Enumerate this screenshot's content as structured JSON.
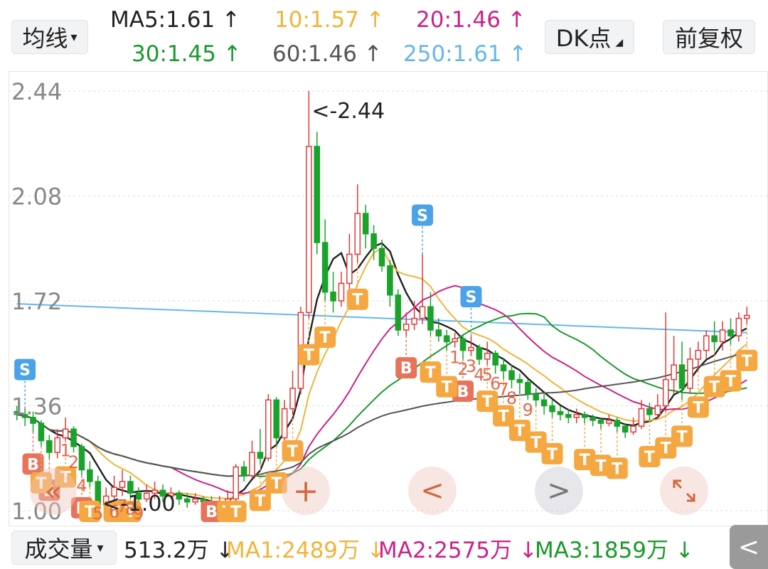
{
  "top": {
    "indicator_label": "均线",
    "dk_label": "DK点",
    "adjust_label": "前复权",
    "ma_lines": [
      {
        "text": "MA5:1.61",
        "arrow": "up",
        "color": "#222222"
      },
      {
        "text": "10:1.57",
        "arrow": "up",
        "color": "#f0b43c"
      },
      {
        "text": "20:1.46",
        "arrow": "up",
        "color": "#cc2288"
      },
      {
        "text": "30:1.45",
        "arrow": "up",
        "color": "#1a9a2a"
      },
      {
        "text": "60:1.46",
        "arrow": "up",
        "color": "#555555"
      },
      {
        "text": "250:1.61",
        "arrow": "up",
        "color": "#66b6ee"
      }
    ]
  },
  "bottom": {
    "volume_label": "成交量",
    "volume_value": "513.2万",
    "ma1": "MA1:2489万",
    "ma2": "MA2:2575万",
    "ma3": "MA3:1859万"
  },
  "controls": {
    "zoom_in": "+",
    "prev": "<",
    "next": ">",
    "rewind": "«",
    "fullscreen": "expand-icon",
    "back": "<"
  },
  "chart_data": {
    "type": "candlestick",
    "y_axis_ticks": [
      "2.44",
      "2.08",
      "1.72",
      "1.36",
      "1.00"
    ],
    "ylim": [
      1.0,
      2.44
    ],
    "max_label": "<-2.44",
    "min_label": "<-1.00",
    "colors": {
      "up": "#e23a3a",
      "down": "#1aa32a",
      "ma5": "#222222",
      "ma10": "#f0b43c",
      "ma20": "#cc2288",
      "ma30": "#1a9a2a",
      "ma60": "#555555",
      "ma250": "#66b6ee",
      "t_badge": "#f5a742",
      "s_badge": "#4aa3e8",
      "b_badge": "#e8735a"
    },
    "candles": [
      [
        1.34,
        1.33,
        1.36,
        1.31
      ],
      [
        1.33,
        1.32,
        1.35,
        1.29
      ],
      [
        1.32,
        1.3,
        1.34,
        1.27
      ],
      [
        1.3,
        1.24,
        1.31,
        1.22
      ],
      [
        1.24,
        1.2,
        1.26,
        1.18
      ],
      [
        1.2,
        1.25,
        1.28,
        1.18
      ],
      [
        1.25,
        1.28,
        1.32,
        1.24
      ],
      [
        1.28,
        1.22,
        1.29,
        1.2
      ],
      [
        1.22,
        1.14,
        1.23,
        1.12
      ],
      [
        1.14,
        1.1,
        1.17,
        1.08
      ],
      [
        1.1,
        1.02,
        1.12,
        1.0
      ],
      [
        1.02,
        1.05,
        1.08,
        1.0
      ],
      [
        1.05,
        1.08,
        1.12,
        1.03
      ],
      [
        1.08,
        1.1,
        1.14,
        1.05
      ],
      [
        1.1,
        1.06,
        1.12,
        1.04
      ],
      [
        1.06,
        1.04,
        1.08,
        1.02
      ],
      [
        1.04,
        1.06,
        1.09,
        1.03
      ],
      [
        1.06,
        1.07,
        1.1,
        1.04
      ],
      [
        1.07,
        1.05,
        1.09,
        1.03
      ],
      [
        1.05,
        1.06,
        1.08,
        1.04
      ],
      [
        1.06,
        1.04,
        1.07,
        1.02
      ],
      [
        1.04,
        1.03,
        1.06,
        1.01
      ],
      [
        1.03,
        1.04,
        1.06,
        1.02
      ],
      [
        1.04,
        1.03,
        1.05,
        1.01
      ],
      [
        1.03,
        1.02,
        1.05,
        1.0
      ],
      [
        1.02,
        1.03,
        1.05,
        1.01
      ],
      [
        1.03,
        1.04,
        1.07,
        1.02
      ],
      [
        1.04,
        1.15,
        1.16,
        1.03
      ],
      [
        1.15,
        1.12,
        1.17,
        1.1
      ],
      [
        1.12,
        1.2,
        1.24,
        1.11
      ],
      [
        1.2,
        1.18,
        1.28,
        1.16
      ],
      [
        1.18,
        1.38,
        1.4,
        1.17
      ],
      [
        1.38,
        1.25,
        1.39,
        1.22
      ],
      [
        1.25,
        1.35,
        1.38,
        1.24
      ],
      [
        1.35,
        1.42,
        1.48,
        1.33
      ],
      [
        1.42,
        1.68,
        1.7,
        1.4
      ],
      [
        1.68,
        2.25,
        2.44,
        1.66
      ],
      [
        2.25,
        1.92,
        2.3,
        1.88
      ],
      [
        1.92,
        1.75,
        2.0,
        1.72
      ],
      [
        1.75,
        1.72,
        1.82,
        1.68
      ],
      [
        1.72,
        1.78,
        1.82,
        1.7
      ],
      [
        1.78,
        1.88,
        1.95,
        1.76
      ],
      [
        1.88,
        2.02,
        2.12,
        1.85
      ],
      [
        2.02,
        1.95,
        2.05,
        1.9
      ],
      [
        1.95,
        1.9,
        1.98,
        1.86
      ],
      [
        1.9,
        1.84,
        1.93,
        1.82
      ],
      [
        1.84,
        1.74,
        1.86,
        1.7
      ],
      [
        1.74,
        1.62,
        1.76,
        1.6
      ],
      [
        1.62,
        1.64,
        1.68,
        1.6
      ],
      [
        1.64,
        1.66,
        1.72,
        1.62
      ],
      [
        1.66,
        1.7,
        1.88,
        1.64
      ],
      [
        1.7,
        1.62,
        1.75,
        1.6
      ],
      [
        1.62,
        1.6,
        1.66,
        1.58
      ],
      [
        1.6,
        1.58,
        1.62,
        1.55
      ],
      [
        1.58,
        1.59,
        1.61,
        1.56
      ],
      [
        1.59,
        1.55,
        1.6,
        1.52
      ],
      [
        1.55,
        1.56,
        1.6,
        1.53
      ],
      [
        1.56,
        1.52,
        1.57,
        1.5
      ],
      [
        1.52,
        1.54,
        1.58,
        1.5
      ],
      [
        1.54,
        1.5,
        1.55,
        1.47
      ],
      [
        1.5,
        1.48,
        1.52,
        1.45
      ],
      [
        1.48,
        1.45,
        1.5,
        1.42
      ],
      [
        1.45,
        1.44,
        1.47,
        1.4
      ],
      [
        1.44,
        1.4,
        1.45,
        1.38
      ],
      [
        1.4,
        1.38,
        1.42,
        1.36
      ],
      [
        1.38,
        1.36,
        1.4,
        1.33
      ],
      [
        1.36,
        1.34,
        1.38,
        1.32
      ],
      [
        1.34,
        1.33,
        1.36,
        1.31
      ],
      [
        1.33,
        1.32,
        1.35,
        1.3
      ],
      [
        1.32,
        1.33,
        1.35,
        1.3
      ],
      [
        1.33,
        1.32,
        1.34,
        1.3
      ],
      [
        1.32,
        1.31,
        1.33,
        1.29
      ],
      [
        1.31,
        1.3,
        1.32,
        1.28
      ],
      [
        1.3,
        1.31,
        1.33,
        1.29
      ],
      [
        1.31,
        1.29,
        1.32,
        1.27
      ],
      [
        1.29,
        1.27,
        1.3,
        1.25
      ],
      [
        1.27,
        1.29,
        1.32,
        1.26
      ],
      [
        1.29,
        1.35,
        1.38,
        1.28
      ],
      [
        1.35,
        1.33,
        1.37,
        1.31
      ],
      [
        1.33,
        1.36,
        1.4,
        1.32
      ],
      [
        1.36,
        1.45,
        1.68,
        1.34
      ],
      [
        1.45,
        1.5,
        1.6,
        1.4
      ],
      [
        1.5,
        1.42,
        1.58,
        1.38
      ],
      [
        1.42,
        1.52,
        1.56,
        1.4
      ],
      [
        1.52,
        1.55,
        1.58,
        1.48
      ],
      [
        1.55,
        1.6,
        1.62,
        1.52
      ],
      [
        1.6,
        1.58,
        1.65,
        1.55
      ],
      [
        1.58,
        1.62,
        1.65,
        1.55
      ],
      [
        1.62,
        1.6,
        1.66,
        1.57
      ],
      [
        1.6,
        1.66,
        1.68,
        1.58
      ],
      [
        1.66,
        1.67,
        1.7,
        1.64
      ]
    ],
    "markers": [
      {
        "type": "S",
        "i": 1
      },
      {
        "type": "S",
        "i": 50
      },
      {
        "type": "S",
        "i": 56
      },
      {
        "type": "B",
        "i": 4
      },
      {
        "type": "B",
        "i": 8
      },
      {
        "type": "B",
        "i": 2
      },
      {
        "type": "B",
        "i": 24
      },
      {
        "type": "B",
        "i": 48
      },
      {
        "type": "B",
        "i": 55
      },
      {
        "type": "T",
        "i": 3
      },
      {
        "type": "T",
        "i": 6
      },
      {
        "type": "T",
        "i": 9
      },
      {
        "type": "T",
        "i": 12
      },
      {
        "type": "T",
        "i": 14
      },
      {
        "type": "T",
        "i": 26
      },
      {
        "type": "T",
        "i": 27
      },
      {
        "type": "T",
        "i": 30
      },
      {
        "type": "T",
        "i": 32
      },
      {
        "type": "T",
        "i": 34
      },
      {
        "type": "T",
        "i": 36
      },
      {
        "type": "T",
        "i": 38
      },
      {
        "type": "T",
        "i": 42
      },
      {
        "type": "T",
        "i": 51
      },
      {
        "type": "T",
        "i": 53
      },
      {
        "type": "T",
        "i": 58
      },
      {
        "type": "T",
        "i": 60
      },
      {
        "type": "T",
        "i": 62
      },
      {
        "type": "T",
        "i": 64
      },
      {
        "type": "T",
        "i": 66
      },
      {
        "type": "T",
        "i": 70
      },
      {
        "type": "T",
        "i": 72
      },
      {
        "type": "T",
        "i": 74
      },
      {
        "type": "T",
        "i": 78
      },
      {
        "type": "T",
        "i": 80
      },
      {
        "type": "T",
        "i": 82
      },
      {
        "type": "T",
        "i": 84
      },
      {
        "type": "T",
        "i": 86
      },
      {
        "type": "T",
        "i": 88
      },
      {
        "type": "T",
        "i": 90
      }
    ],
    "count_labels": [
      {
        "text": "1",
        "i": 6
      },
      {
        "text": "2",
        "i": 7
      },
      {
        "text": "4",
        "i": 8
      },
      {
        "text": "5",
        "i": 10
      },
      {
        "text": "6",
        "i": 12
      },
      {
        "text": "7",
        "i": 13
      },
      {
        "text": "8",
        "i": 14
      },
      {
        "text": "9",
        "i": 15
      },
      {
        "text": "1",
        "i": 54
      },
      {
        "text": "2",
        "i": 55
      },
      {
        "text": "3",
        "i": 56
      },
      {
        "text": "4",
        "i": 57
      },
      {
        "text": "5",
        "i": 58
      },
      {
        "text": "6",
        "i": 59
      },
      {
        "text": "7",
        "i": 60
      },
      {
        "text": "8",
        "i": 61
      },
      {
        "text": "9",
        "i": 63
      }
    ]
  }
}
